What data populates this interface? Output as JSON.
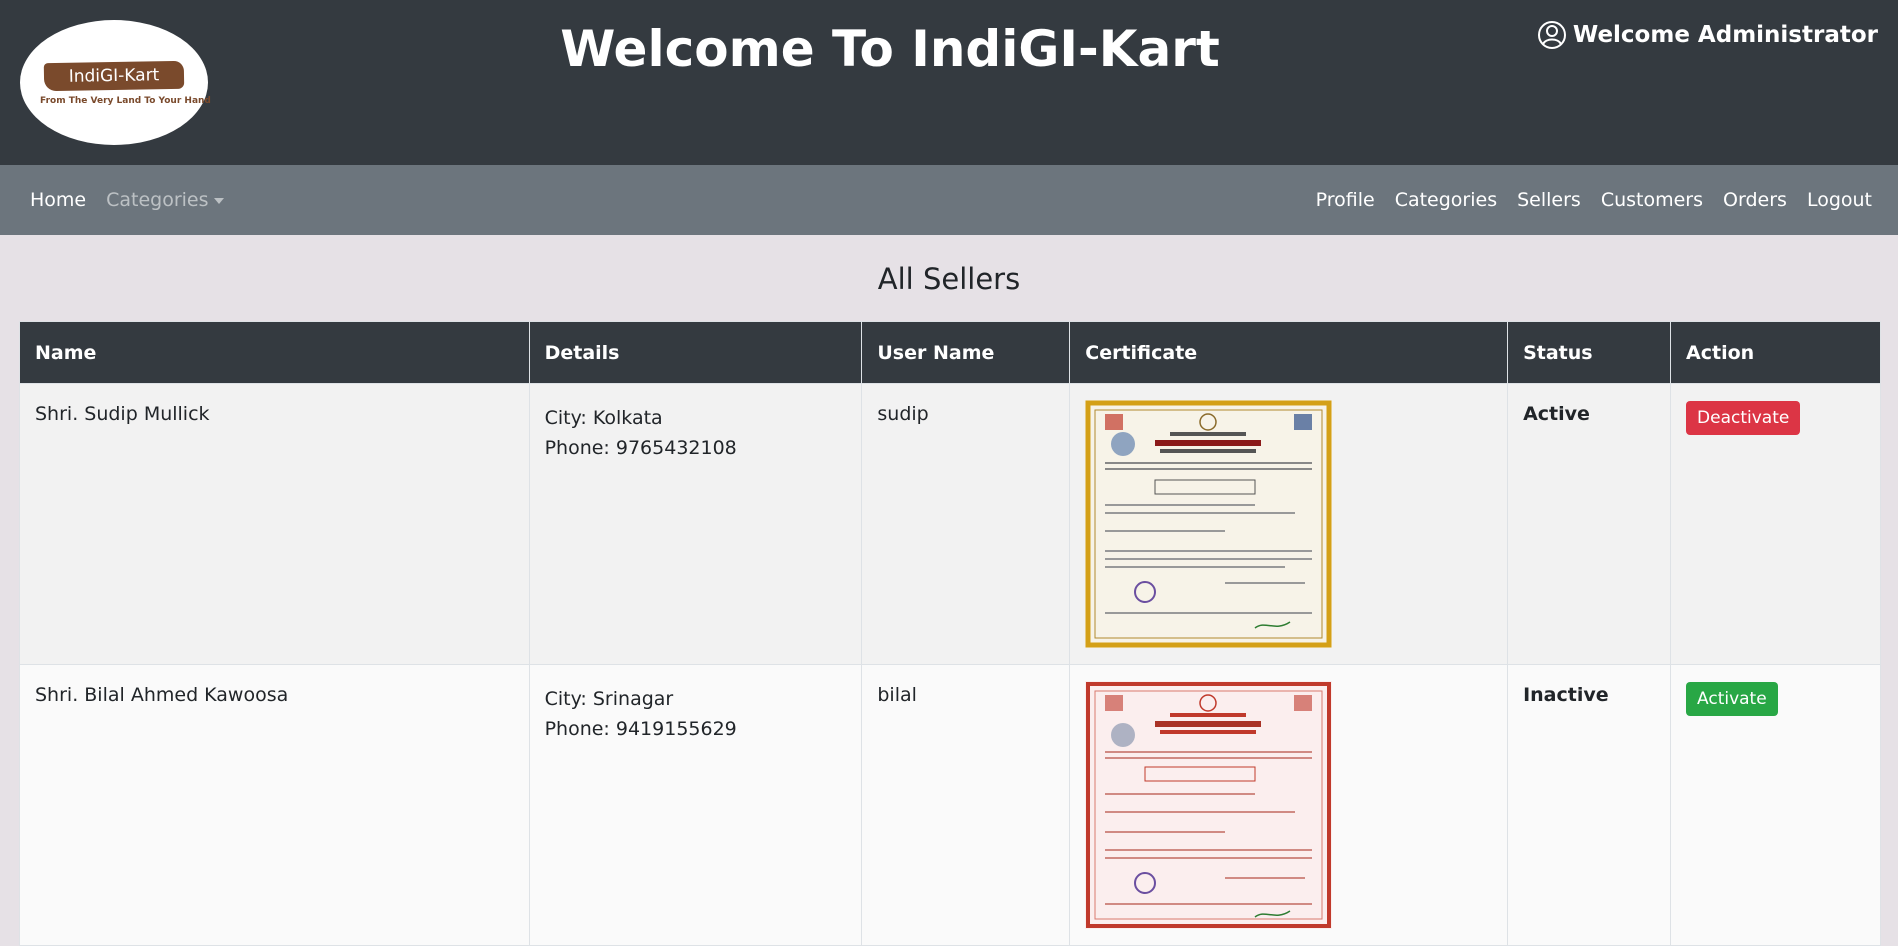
{
  "header": {
    "logo_text": "IndiGI-Kart",
    "logo_tagline": "From The Very Land To Your Hand",
    "title": "Welcome To IndiGI-Kart",
    "welcome_user": "Welcome Administrator",
    "user_icon": "user-circle-icon"
  },
  "navbar": {
    "left": [
      {
        "label": "Home"
      },
      {
        "label": "Categories"
      }
    ],
    "right": [
      {
        "label": "Profile"
      },
      {
        "label": "Categories"
      },
      {
        "label": "Sellers"
      },
      {
        "label": "Customers"
      },
      {
        "label": "Orders"
      },
      {
        "label": "Logout"
      }
    ]
  },
  "page": {
    "heading": "All Sellers"
  },
  "table": {
    "columns": [
      "Name",
      "Details",
      "User Name",
      "Certificate",
      "Status",
      "Action"
    ],
    "rows": [
      {
        "name": "Shri. Sudip Mullick",
        "city": "City: Kolkata",
        "phone": "Phone: 9765432108",
        "username": "sudip",
        "certificate_icon": "gi-certificate-image",
        "status": "Active",
        "action": "Deactivate"
      },
      {
        "name": "Shri. Bilal Ahmed Kawoosa",
        "city": "City: Srinagar",
        "phone": "Phone: 9419155629",
        "username": "bilal",
        "certificate_icon": "gi-certificate-image",
        "status": "Inactive",
        "action": "Activate"
      }
    ]
  },
  "colors": {
    "header_bg": "#343a40",
    "navbar_bg": "#6c757d",
    "deactivate": "#dc3545",
    "activate": "#28a745",
    "certificate_gold": "#d4a017",
    "certificate_red": "#c0392b"
  }
}
